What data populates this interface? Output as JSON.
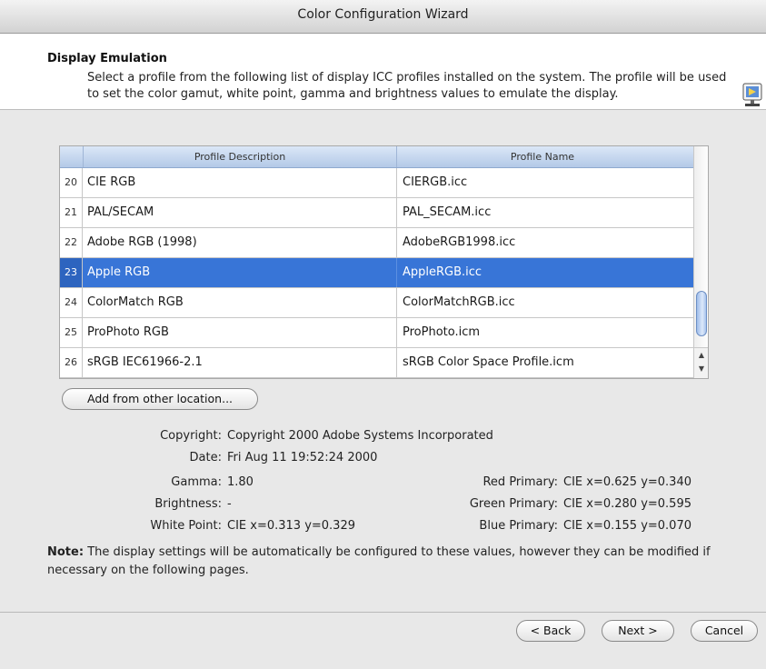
{
  "window": {
    "title": "Color Configuration Wizard"
  },
  "header": {
    "heading": "Display Emulation",
    "description": "Select a profile from the following list of display ICC profiles installed on the system. The profile will be used to set the color gamut, white point, gamma and brightness values to emulate the display."
  },
  "table": {
    "columns": [
      "Profile Description",
      "Profile Name"
    ],
    "rows": [
      {
        "index": "20",
        "description": "CIE RGB",
        "name": "CIERGB.icc"
      },
      {
        "index": "21",
        "description": "PAL/SECAM",
        "name": "PAL_SECAM.icc"
      },
      {
        "index": "22",
        "description": "Adobe RGB (1998)",
        "name": "AdobeRGB1998.icc"
      },
      {
        "index": "23",
        "description": "Apple RGB",
        "name": "AppleRGB.icc"
      },
      {
        "index": "24",
        "description": "ColorMatch RGB",
        "name": "ColorMatchRGB.icc"
      },
      {
        "index": "25",
        "description": "ProPhoto RGB",
        "name": "ProPhoto.icm"
      },
      {
        "index": "26",
        "description": "sRGB IEC61966-2.1",
        "name": "sRGB Color Space Profile.icm"
      }
    ],
    "selected_index": "23"
  },
  "buttons": {
    "add_location": "Add from other location...",
    "back": "< Back",
    "next": "Next >",
    "cancel": "Cancel"
  },
  "details": {
    "copyright_label": "Copyright:",
    "copyright_value": "Copyright 2000 Adobe Systems Incorporated",
    "date_label": "Date:",
    "date_value": "Fri Aug 11 19:52:24 2000",
    "gamma_label": "Gamma:",
    "gamma_value": "1.80",
    "brightness_label": "Brightness:",
    "brightness_value": "-",
    "white_point_label": "White Point:",
    "white_point_value": "CIE x=0.313 y=0.329",
    "red_label": "Red Primary:",
    "red_value": "CIE x=0.625 y=0.340",
    "green_label": "Green Primary:",
    "green_value": "CIE x=0.280 y=0.595",
    "blue_label": "Blue Primary:",
    "blue_value": "CIE x=0.155 y=0.070"
  },
  "note": {
    "label": "Note:",
    "text": "The display settings will be automatically be configured to these values, however they can be modified if necessary on the following pages."
  },
  "colors": {
    "selection": "#3875d7",
    "header_gradient_top": "#dbe7f7"
  },
  "icons": {
    "wizard": "monitor-color-icon"
  }
}
